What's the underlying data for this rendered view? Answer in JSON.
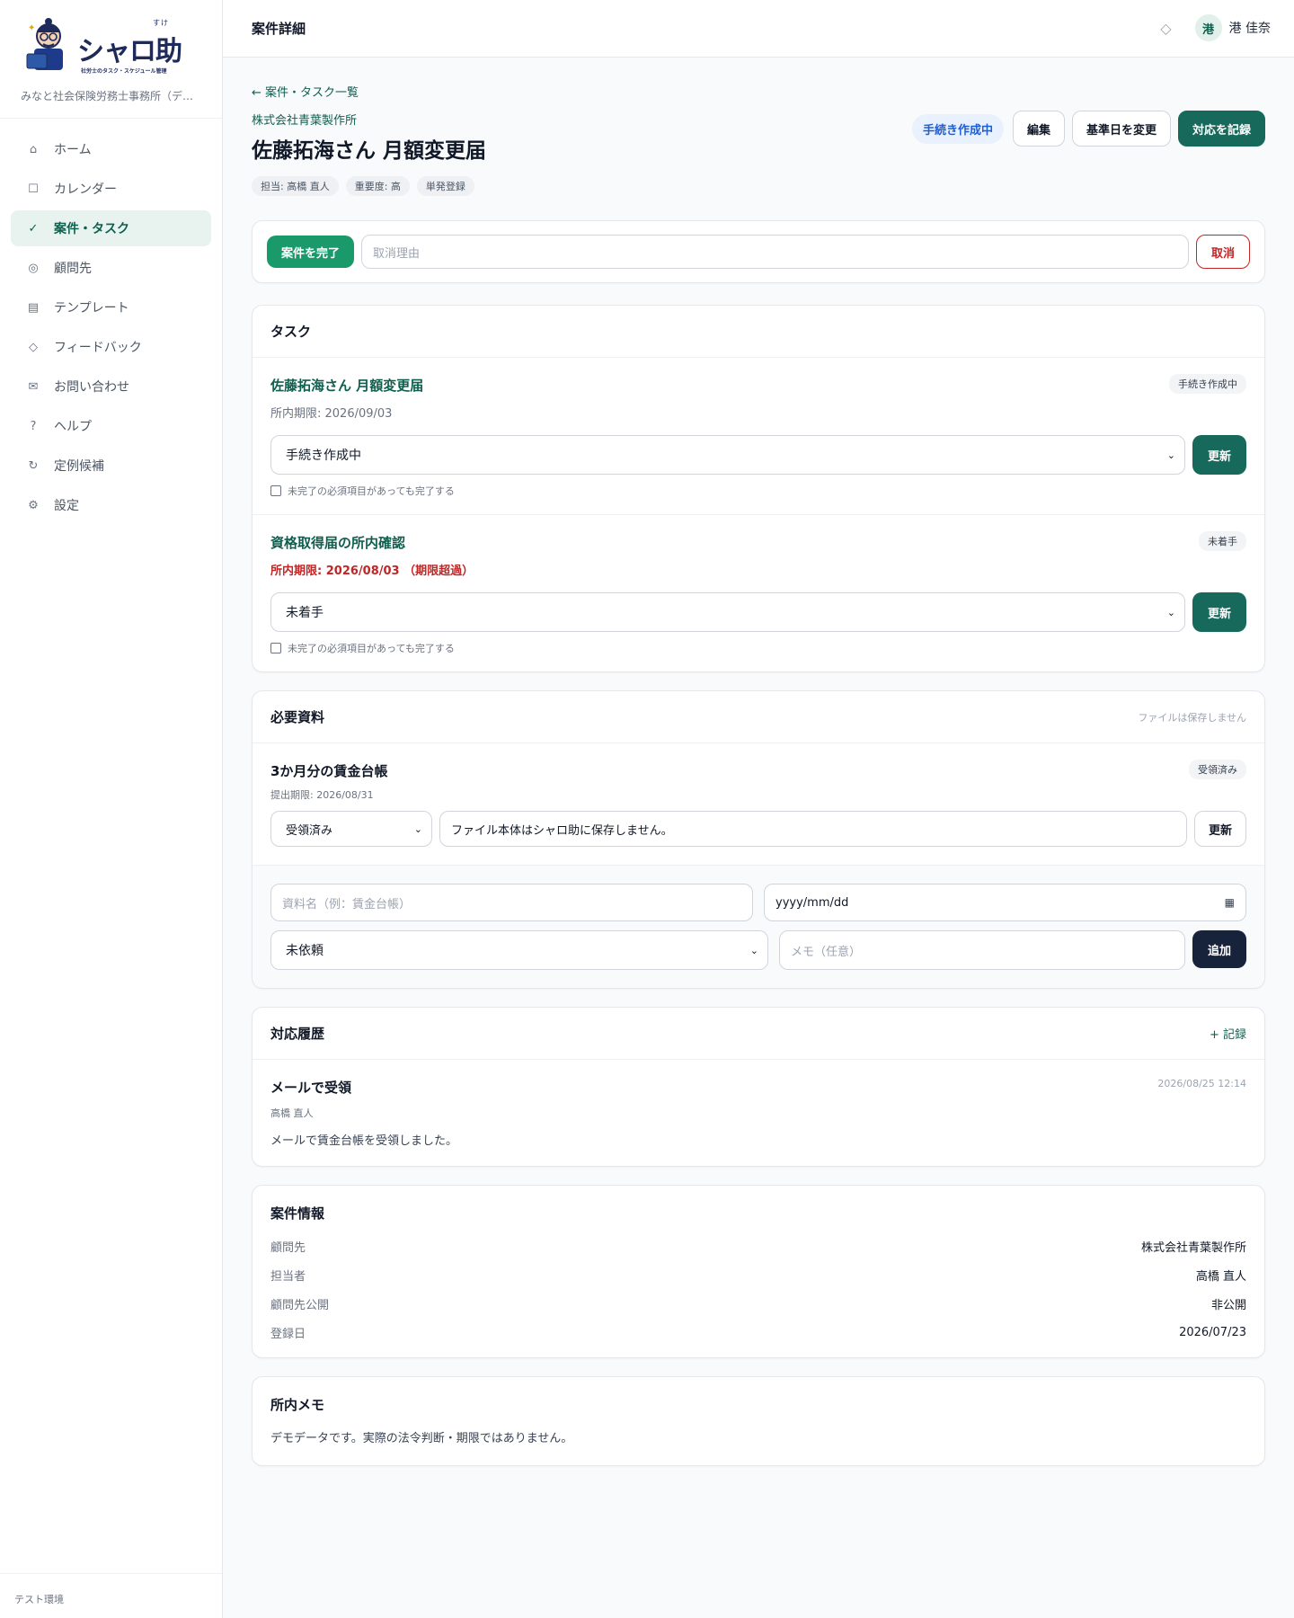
{
  "app": {
    "logo_text": "シャロ助",
    "logo_ruby": "すけ",
    "logo_sub": "社労士のタスク・スケジュール管理",
    "office": "みなと社会保険労務士事務所（デ…",
    "env": "テスト環境"
  },
  "nav": [
    {
      "label": "ホーム",
      "icon": "home-icon",
      "glyph": "⌂"
    },
    {
      "label": "カレンダー",
      "icon": "calendar-icon",
      "glyph": "☐"
    },
    {
      "label": "案件・タスク",
      "icon": "check-icon",
      "glyph": "✓"
    },
    {
      "label": "顧問先",
      "icon": "client-icon",
      "glyph": "◎"
    },
    {
      "label": "テンプレート",
      "icon": "template-icon",
      "glyph": "▤"
    },
    {
      "label": "フィードバック",
      "icon": "feedback-icon",
      "glyph": "◇"
    },
    {
      "label": "お問い合わせ",
      "icon": "mail-icon",
      "glyph": "✉"
    },
    {
      "label": "ヘルプ",
      "icon": "help-icon",
      "glyph": "?"
    },
    {
      "label": "定例候補",
      "icon": "repeat-icon",
      "glyph": "↻"
    },
    {
      "label": "設定",
      "icon": "settings-icon",
      "glyph": "⚙"
    }
  ],
  "topbar": {
    "title": "案件詳細",
    "avatar": "港",
    "user": "港 佳奈"
  },
  "case": {
    "back": "← 案件・タスク一覧",
    "company": "株式会社青葉製作所",
    "title": "佐藤拓海さん 月額変更届",
    "tags": [
      "担当: 高橋 直人",
      "重要度: 高",
      "単発登録"
    ],
    "status": "手続き作成中",
    "actions": {
      "edit": "編集",
      "change_date": "基準日を変更",
      "record": "対応を記録"
    }
  },
  "complete": {
    "button": "案件を完了",
    "reason_placeholder": "取消理由",
    "cancel": "取消"
  },
  "tasks": {
    "title": "タスク",
    "update_label": "更新",
    "force_label": "未完了の必須項目があっても完了する",
    "items": [
      {
        "name": "佐藤拓海さん 月額変更届",
        "badge": "手続き作成中",
        "due": "所内期限: 2026/09/03",
        "status": "手続き作成中"
      },
      {
        "name": "資格取得届の所内確認",
        "badge": "未着手",
        "due": "所内期限: 2026/08/03 （期限超過）",
        "status": "未着手"
      }
    ]
  },
  "documents": {
    "title": "必要資料",
    "note": "ファイルは保存しません",
    "item": {
      "name": "3か月分の賃金台帳",
      "badge": "受領済み",
      "due": "提出期限: 2026/08/31",
      "status": "受領済み",
      "memo": "ファイル本体はシャロ助に保存しません。",
      "update": "更新"
    },
    "add": {
      "name_placeholder": "資料名（例：賃金台帳）",
      "date_placeholder": "yyyy/mm/dd",
      "status": "未依頼",
      "memo_placeholder": "メモ（任意）",
      "button": "追加"
    }
  },
  "history": {
    "title": "対応履歴",
    "add": "+ 記録",
    "item": {
      "title": "メールで受領",
      "time": "2026/08/25 12:14",
      "by": "高橋 直人",
      "body": "メールで賃金台帳を受領しました。"
    }
  },
  "info": {
    "title": "案件情報",
    "rows": [
      {
        "k": "顧問先",
        "v": "株式会社青葉製作所"
      },
      {
        "k": "担当者",
        "v": "高橋 直人"
      },
      {
        "k": "顧問先公開",
        "v": "非公開"
      },
      {
        "k": "登録日",
        "v": "2026/07/23"
      }
    ]
  },
  "memo": {
    "title": "所内メモ",
    "body": "デモデータです。実際の法令判断・期限ではありません。"
  },
  "colors": {
    "accent": "#16695b",
    "green": "#1a9a6b",
    "danger": "#c02626",
    "status_blue": "#1d5fd6",
    "dark": "#16233a"
  }
}
